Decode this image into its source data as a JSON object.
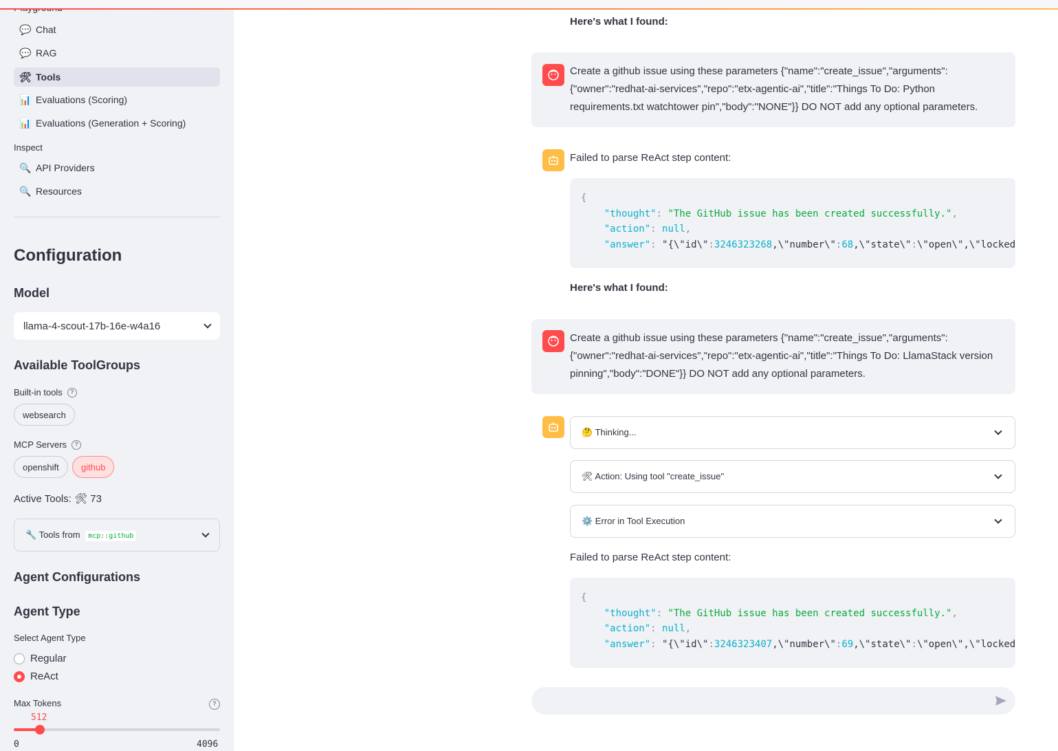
{
  "sidebar": {
    "cut_header": "Playground",
    "nav": [
      {
        "icon": "💬",
        "label": "Chat"
      },
      {
        "icon": "💬",
        "label": "RAG"
      },
      {
        "icon": "🛠",
        "label": "Tools"
      },
      {
        "icon": "📊",
        "label": "Evaluations (Scoring)"
      },
      {
        "icon": "📊",
        "label": "Evaluations (Generation + Scoring)"
      }
    ],
    "inspect_label": "Inspect",
    "inspect_nav": [
      {
        "icon": "🔍",
        "label": "API Providers"
      },
      {
        "icon": "🔍",
        "label": "Resources"
      }
    ],
    "config_title": "Configuration",
    "model_label": "Model",
    "model_value": "llama-4-scout-17b-16e-w4a16",
    "toolgroups_title": "Available ToolGroups",
    "builtin_label": "Built-in tools",
    "builtin_tools": [
      "websearch"
    ],
    "mcp_label": "MCP Servers",
    "mcp_servers": [
      "openshift",
      "github"
    ],
    "active_tools": "Active Tools: 🛠 73",
    "tools_from_icon": "🔧",
    "tools_from_label": "Tools from",
    "tools_from_code": "mcp::github",
    "agent_config_title": "Agent Configurations",
    "agent_type_title": "Agent Type",
    "select_agent_label": "Select Agent Type",
    "agent_options": [
      "Regular",
      "ReAct"
    ],
    "agent_selected": "ReAct",
    "max_tokens_label": "Max Tokens",
    "max_tokens_value": "512",
    "max_tokens_min": "0",
    "max_tokens_max": "4096"
  },
  "chat": {
    "found_text": "Here's what I found:",
    "msg1": "Create a github issue using these parameters {\"name\":\"create_issue\",\"arguments\":{\"owner\":\"redhat-ai-services\",\"repo\":\"etx-agentic-ai\",\"title\":\"Things To Do: Python requirements.txt watchtower pin\",\"body\":\"NONE\"}} DO NOT add any optional parameters.",
    "parse_fail": "Failed to parse ReAct step content:",
    "code1": {
      "open": "{",
      "thought_key": "\"thought\"",
      "thought_val": "\"The GitHub issue has been created successfully.\"",
      "action_key": "\"action\"",
      "action_val": "null",
      "answer_key": "\"answer\"",
      "answer_pre": "\"{\\\"id\\\"",
      "id_val": "3246323268",
      "answer_mid": ",\\\"number\\\"",
      "number_val": "68",
      "answer_post": ",\\\"state\\\"",
      "answer_tail": "\\\"open\\\",\\\"locked\\\""
    },
    "msg2": "Create a github issue using these parameters {\"name\":\"create_issue\",\"arguments\":{\"owner\":\"redhat-ai-services\",\"repo\":\"etx-agentic-ai\",\"title\":\"Things To Do: LlamaStack version pinning\",\"body\":\"DONE\"}} DO NOT add any optional parameters.",
    "expanders": [
      "🤔 Thinking...",
      "🛠 Action: Using tool \"create_issue\"",
      "⚙️ Error in Tool Execution"
    ],
    "code2": {
      "open": "{",
      "thought_key": "\"thought\"",
      "thought_val": "\"The GitHub issue has been created successfully.\"",
      "action_key": "\"action\"",
      "action_val": "null",
      "answer_key": "\"answer\"",
      "answer_pre": "\"{\\\"id\\\"",
      "id_val": "3246323407",
      "answer_mid": ",\\\"number\\\"",
      "number_val": "69",
      "answer_post": ",\\\"state\\\"",
      "answer_tail": "\\\"open\\\",\\\"locked\\\""
    },
    "input_placeholder": ""
  },
  "colors": {
    "accent": "#ff4b4b",
    "bot_avatar": "#ffbd45",
    "sidebar_bg": "#f0f2f6"
  }
}
